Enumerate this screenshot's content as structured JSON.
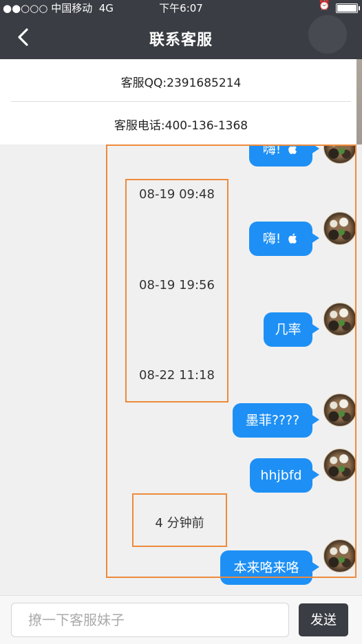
{
  "status_bar": {
    "carrier": "●●○○○ 中国移动",
    "network": "4G",
    "time": "下午6:07"
  },
  "nav": {
    "title": "联系客服"
  },
  "contact": {
    "qq": "客服QQ:2391685214",
    "phone": "客服电话:400-136-1368"
  },
  "messages": [
    {
      "text": "嗨!",
      "icon": "apple-icon"
    },
    {
      "text": "嗨!",
      "icon": "apple-icon"
    },
    {
      "text": "几率"
    },
    {
      "text": "墨菲????"
    },
    {
      "text": "hhjbfd"
    },
    {
      "text": "本来咯来咯"
    }
  ],
  "timestamps": [
    "08-19 09:48",
    "08-19 19:56",
    "08-22 11:18",
    "4 分钟前"
  ],
  "input": {
    "placeholder": "撩一下客服妹子",
    "send_label": "发送"
  },
  "colors": {
    "nav_bg": "#3a3d43",
    "bubble": "#1e90f5",
    "annotation_border": "#ee8a3a"
  }
}
